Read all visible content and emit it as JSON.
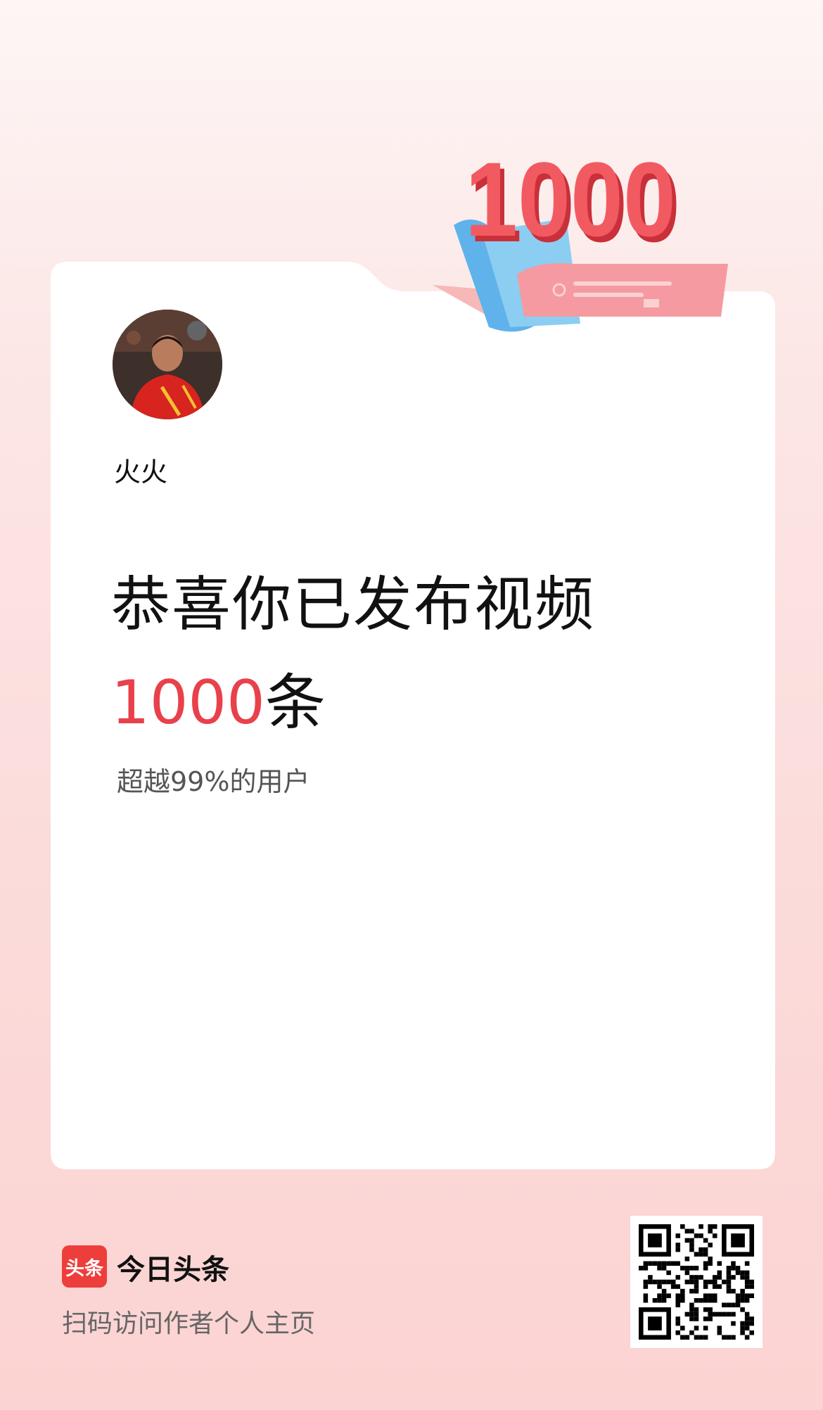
{
  "badge": {
    "number": "1000"
  },
  "profile": {
    "username": "火火"
  },
  "message": {
    "title": "恭喜你已发布视频",
    "count": "1000",
    "unit": "条",
    "subtitle": "超越99%的用户"
  },
  "footer": {
    "logo_text": "头条",
    "app_name": "今日头条",
    "hint": "扫码访问作者个人主页"
  },
  "colors": {
    "accent": "#e8414b",
    "brand": "#ee3e3b"
  }
}
